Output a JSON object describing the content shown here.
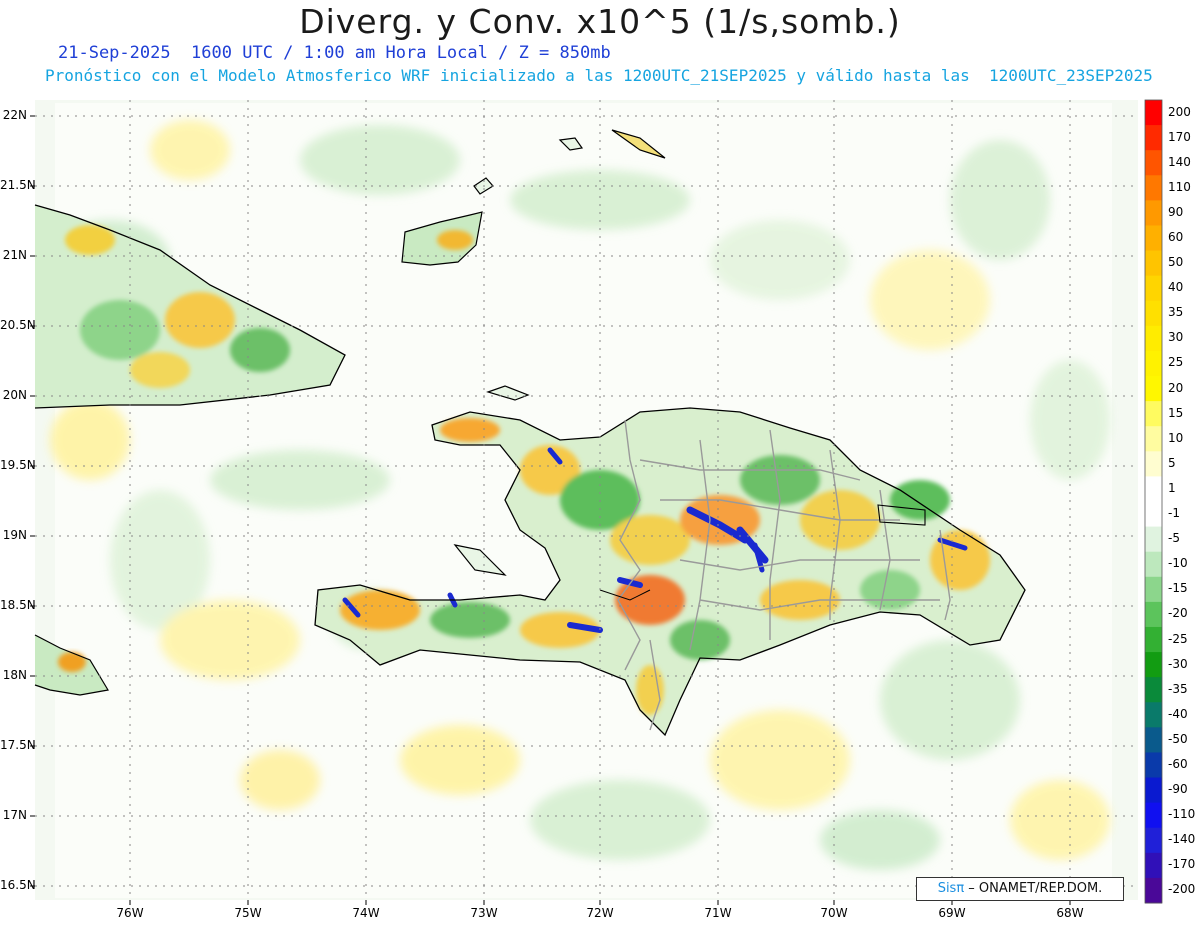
{
  "title": "Diverg. y Conv. x10^5 (1/s,somb.)",
  "subtitle_line1": "21-Sep-2025  1600 UTC / 1:00 am Hora Local / Z = 850mb",
  "subtitle_line2": "Pronóstico con el Modelo Atmosferico WRF inicializado a las 1200UTC_21SEP2025 y válido hasta las  1200UTC_23SEP2025",
  "lat_labels": [
    "22N",
    "21.5N",
    "21N",
    "20.5N",
    "20N",
    "19.5N",
    "19N",
    "18.5N",
    "18N",
    "17.5N",
    "17N",
    "16.5N"
  ],
  "lon_labels": [
    "76W",
    "75W",
    "74W",
    "73W",
    "72W",
    "71W",
    "70W",
    "69W",
    "68W"
  ],
  "colorbar": {
    "labels": [
      "200",
      "170",
      "140",
      "110",
      "90",
      "60",
      "50",
      "40",
      "35",
      "30",
      "25",
      "20",
      "15",
      "10",
      "5",
      "1",
      "-1",
      "-5",
      "-10",
      "-15",
      "-20",
      "-25",
      "-30",
      "-35",
      "-40",
      "-50",
      "-60",
      "-90",
      "-110",
      "-140",
      "-170",
      "-200"
    ],
    "colors": [
      "#ff0000",
      "#ff2a00",
      "#ff5500",
      "#ff7800",
      "#ff9900",
      "#ffb000",
      "#ffc400",
      "#ffd500",
      "#ffe000",
      "#ffec00",
      "#fff200",
      "#fff700",
      "#fffb60",
      "#fffca0",
      "#fffdd0",
      "#ffffff",
      "#ffffff",
      "#e0f3e0",
      "#bde8bd",
      "#8cd68c",
      "#5cc45c",
      "#33b033",
      "#129c12",
      "#0a8a3a",
      "#0a7a6a",
      "#0a5a8c",
      "#0a3aaa",
      "#0a1ad0",
      "#1010f0",
      "#2020d8",
      "#3010b8",
      "#4a0898"
    ]
  },
  "credit": {
    "brand": "Sisπ",
    "org": " – ONAMET/REP.DOM."
  },
  "colors": {
    "ocean_base": "#f2f8ef",
    "coast": "#000000",
    "borders": "#9a9a9a"
  }
}
